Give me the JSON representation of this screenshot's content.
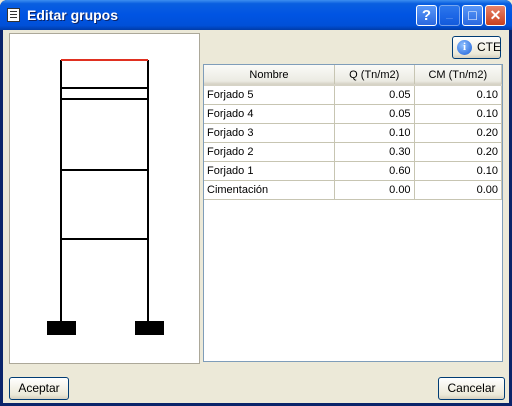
{
  "window": {
    "title": "Editar grupos",
    "controls": {
      "help": "?",
      "minimize": "_",
      "maximize": "□",
      "close": "✕"
    }
  },
  "toolbar": {
    "cte_label": "CTE",
    "cte_icon": "info-icon"
  },
  "table": {
    "columns": [
      "Nombre",
      "Q (Tn/m2)",
      "CM (Tn/m2)"
    ],
    "rows": [
      {
        "name": "Forjado 5",
        "q": "0.05",
        "cm": "0.10"
      },
      {
        "name": "Forjado 4",
        "q": "0.05",
        "cm": "0.10"
      },
      {
        "name": "Forjado 3",
        "q": "0.10",
        "cm": "0.20"
      },
      {
        "name": "Forjado 2",
        "q": "0.30",
        "cm": "0.20"
      },
      {
        "name": "Forjado 1",
        "q": "0.60",
        "cm": "0.10"
      },
      {
        "name": "Cimentación",
        "q": "0.00",
        "cm": "0.00"
      }
    ]
  },
  "footer": {
    "accept_label": "Aceptar",
    "cancel_label": "Cancelar"
  },
  "colors": {
    "titlebar": "#0054e3",
    "selected_floor": "#e03020",
    "frame": "#000000"
  }
}
